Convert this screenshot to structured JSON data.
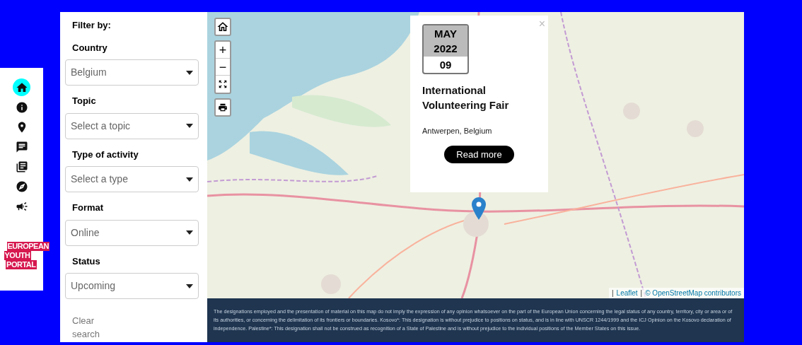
{
  "nav": [
    {
      "selected": true
    },
    {
      "selected": false
    },
    {
      "selected": false
    },
    {
      "selected": false
    },
    {
      "selected": false
    },
    {
      "selected": false
    },
    {
      "selected": false
    }
  ],
  "logo": [
    "EUROPEAN",
    "YOUTH",
    "PORTAL"
  ],
  "filters": {
    "title": "Filter by:",
    "fields": [
      {
        "label": "Country",
        "value": "Belgium"
      },
      {
        "label": "Topic",
        "placeholder": "Select a topic"
      },
      {
        "label": "Type of activity",
        "placeholder": "Select a type"
      },
      {
        "label": "Format",
        "value": "Online"
      },
      {
        "label": "Status",
        "value": "Upcoming"
      }
    ],
    "clear": "Clear search"
  },
  "map": {
    "zoom_in": "+",
    "zoom_out": "−",
    "popup": {
      "close": "×",
      "month": "MAY",
      "year": "2022",
      "day": "09",
      "title": "International Volunteering Fair",
      "location": "Antwerpen, Belgium",
      "button": "Read more"
    },
    "attribution": {
      "separator": "|",
      "links": [
        "Leaflet",
        "© OpenStreetMap contributors"
      ]
    }
  },
  "disclaimer": "The designations employed and the presentation of material on this map do not imply the expression of any opinion whatsoever on the part of the European Union concerning the legal status of any country, territory, city or area or of its authorities, or concerning the delimitation of its frontiers or boundaries. Kosovo*: This designation is without prejudice to positions on status, and is in line with UNSCR 1244/1999 and the ICJ Opinion on the Kosovo declaration of independence. Palestine*: This designation shall not be construed as recognition of a State of Palestine and is without prejudice to the individual positions of the Member States on this issue."
}
